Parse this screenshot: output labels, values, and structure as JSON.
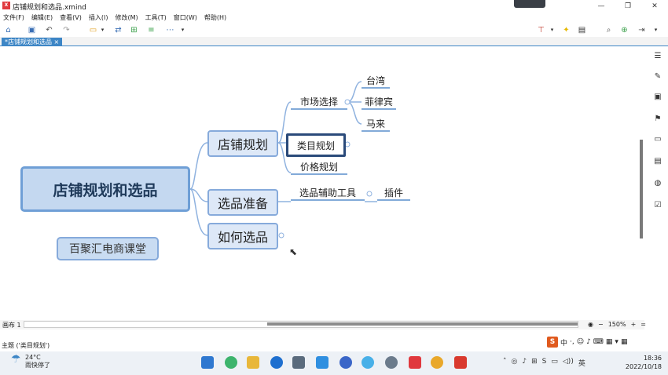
{
  "window": {
    "title": "店铺规划和选品.xmind"
  },
  "menu": [
    "文件(F)",
    "编辑(E)",
    "查看(V)",
    "插入(I)",
    "修改(M)",
    "工具(T)",
    "窗口(W)",
    "帮助(H)"
  ],
  "tab": {
    "label": "*店铺规划和选品 ×"
  },
  "mindmap": {
    "central": "店铺规划和选品",
    "floating": "百聚汇电商课堂",
    "topics": [
      "店铺规划",
      "选品准备",
      "如何选品"
    ],
    "plan_sub": [
      "市场选择",
      "类目规划",
      "价格规划"
    ],
    "market_sub": [
      "台湾",
      "菲律宾",
      "马来"
    ],
    "prep_sub": [
      "选品辅助工具"
    ],
    "tool_sub": [
      "插件"
    ]
  },
  "bottom": {
    "sheet": "画布 1",
    "zoom": "150%",
    "status": "主题 ('类目规划')"
  },
  "ime": {
    "label": "中"
  },
  "weather": {
    "temp": "24°C",
    "desc": "雨快停了"
  },
  "clock": {
    "time": "18:36",
    "date": "2022/10/18"
  },
  "colors": {
    "accent": "#3d86c6",
    "central_fill": "#c4d8f0",
    "topic_fill": "#dde8f7"
  }
}
